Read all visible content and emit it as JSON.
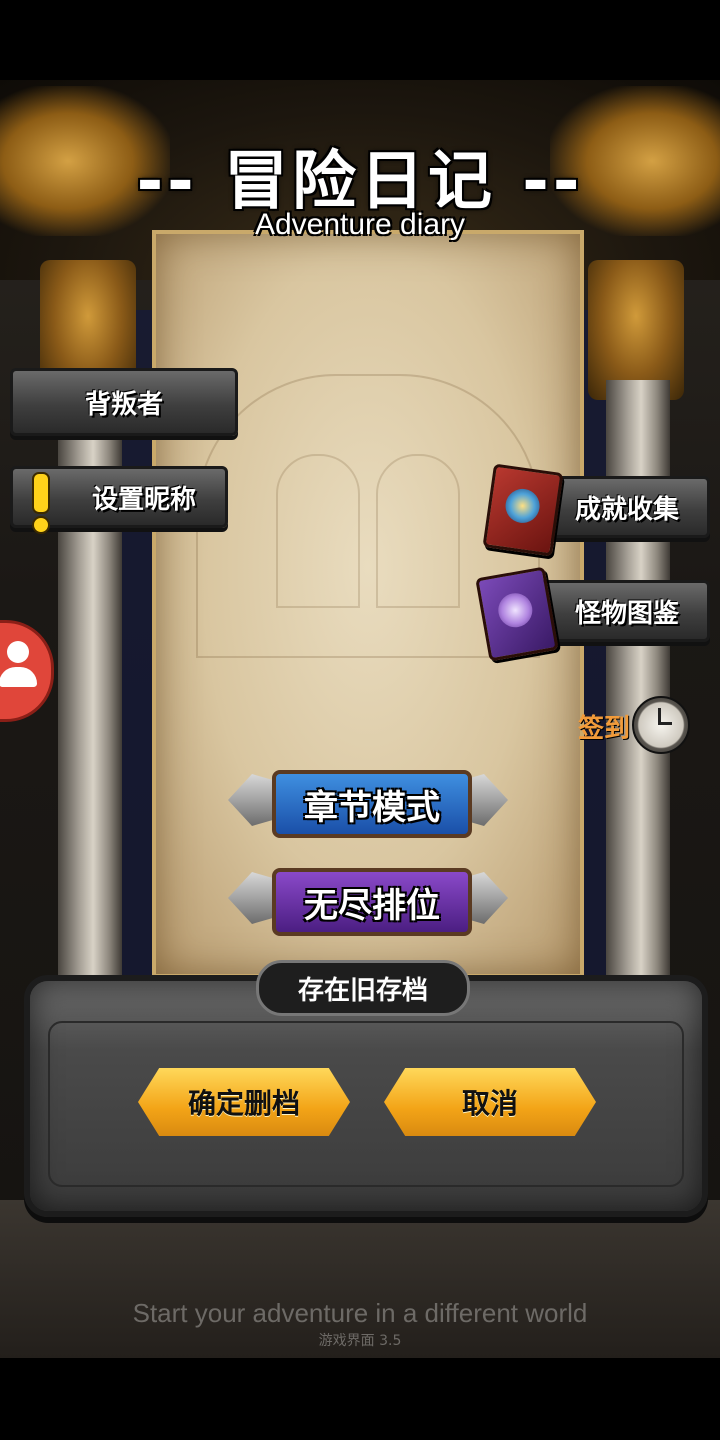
{
  "header": {
    "title": "-- 冒险日记 --",
    "subtitle": "Adventure diary"
  },
  "left_menu": {
    "traitor_label": "背叛者",
    "set_nickname_label": "设置昵称"
  },
  "right_menu": {
    "achievements_label": "成就收集",
    "bestiary_label": "怪物图鉴",
    "signin_label": "签到"
  },
  "modes": {
    "chapter_label": "章节模式",
    "endless_label": "无尽排位"
  },
  "dialog": {
    "title": "存在旧存档",
    "confirm_label": "确定删档",
    "cancel_label": "取消"
  },
  "footer": {
    "tagline": "Start your adventure in a different world",
    "version": "游戏界面 3.5"
  },
  "icons": [
    "alert-icon",
    "achievement-book-icon",
    "monster-book-icon",
    "clock-icon",
    "profile-icon"
  ],
  "colors": {
    "signin_text": "#f29b3a",
    "chapter_button": "#2a6fd0",
    "endless_button": "#6a33a8",
    "dialog_button": "#f3a417"
  }
}
